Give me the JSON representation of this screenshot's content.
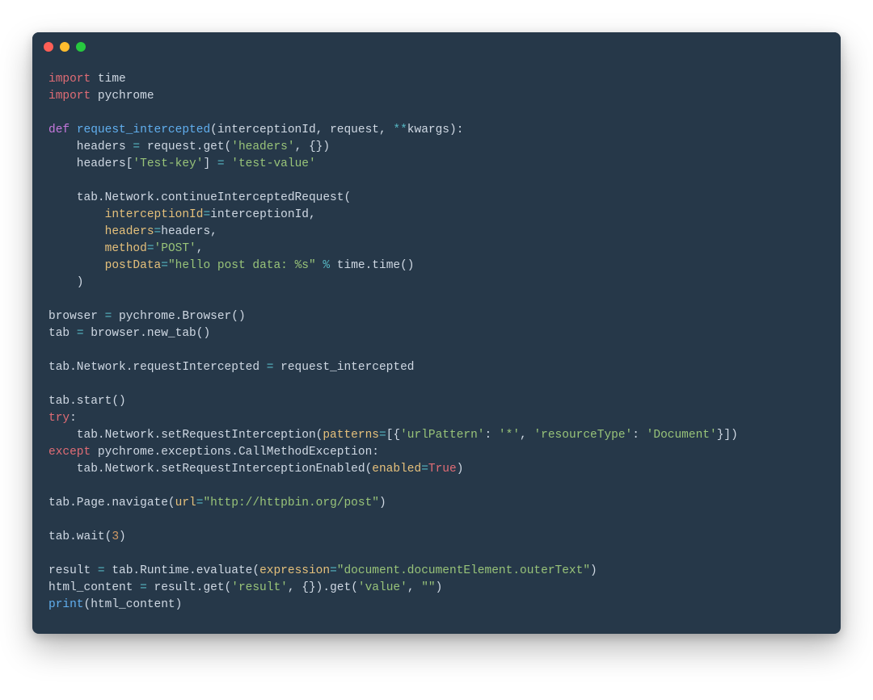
{
  "window": {
    "traffic_lights": [
      "red",
      "yellow",
      "green"
    ]
  },
  "code": {
    "tokens": [
      [
        [
          "import",
          "keyword"
        ],
        [
          " time",
          "default"
        ]
      ],
      [
        [
          "import",
          "keyword"
        ],
        [
          " pychrome",
          "default"
        ]
      ],
      [
        [
          "",
          "default"
        ]
      ],
      [
        [
          "def ",
          "keyword2"
        ],
        [
          "request_intercepted",
          "func"
        ],
        [
          "(interceptionId, request, ",
          "default"
        ],
        [
          "**",
          "op"
        ],
        [
          "kwargs):",
          "default"
        ]
      ],
      [
        [
          "    headers ",
          "default"
        ],
        [
          "=",
          "op"
        ],
        [
          " request.get(",
          "default"
        ],
        [
          "'headers'",
          "string"
        ],
        [
          ", {})",
          "default"
        ]
      ],
      [
        [
          "    headers[",
          "default"
        ],
        [
          "'Test-key'",
          "string"
        ],
        [
          "] ",
          "default"
        ],
        [
          "=",
          "op"
        ],
        [
          " ",
          "default"
        ],
        [
          "'test-value'",
          "string"
        ]
      ],
      [
        [
          "",
          "default"
        ]
      ],
      [
        [
          "    tab.Network.continueInterceptedRequest(",
          "default"
        ]
      ],
      [
        [
          "        ",
          "default"
        ],
        [
          "interceptionId",
          "param"
        ],
        [
          "=",
          "op"
        ],
        [
          "interceptionId,",
          "default"
        ]
      ],
      [
        [
          "        ",
          "default"
        ],
        [
          "headers",
          "param"
        ],
        [
          "=",
          "op"
        ],
        [
          "headers,",
          "default"
        ]
      ],
      [
        [
          "        ",
          "default"
        ],
        [
          "method",
          "param"
        ],
        [
          "=",
          "op"
        ],
        [
          "'POST'",
          "string"
        ],
        [
          ",",
          "default"
        ]
      ],
      [
        [
          "        ",
          "default"
        ],
        [
          "postData",
          "param"
        ],
        [
          "=",
          "op"
        ],
        [
          "\"hello post data: %s\"",
          "string"
        ],
        [
          " ",
          "default"
        ],
        [
          "%",
          "op"
        ],
        [
          " time.time()",
          "default"
        ]
      ],
      [
        [
          "    )",
          "default"
        ]
      ],
      [
        [
          "",
          "default"
        ]
      ],
      [
        [
          "browser ",
          "default"
        ],
        [
          "=",
          "op"
        ],
        [
          " pychrome.Browser()",
          "default"
        ]
      ],
      [
        [
          "tab ",
          "default"
        ],
        [
          "=",
          "op"
        ],
        [
          " browser.new_tab()",
          "default"
        ]
      ],
      [
        [
          "",
          "default"
        ]
      ],
      [
        [
          "tab.Network.requestIntercepted ",
          "default"
        ],
        [
          "=",
          "op"
        ],
        [
          " request_intercepted",
          "default"
        ]
      ],
      [
        [
          "",
          "default"
        ]
      ],
      [
        [
          "tab.start()",
          "default"
        ]
      ],
      [
        [
          "try",
          "keyword"
        ],
        [
          ":",
          "default"
        ]
      ],
      [
        [
          "    tab.Network.setRequestInterception(",
          "default"
        ],
        [
          "patterns",
          "param"
        ],
        [
          "=",
          "op"
        ],
        [
          "[{",
          "default"
        ],
        [
          "'urlPattern'",
          "string"
        ],
        [
          ": ",
          "default"
        ],
        [
          "'*'",
          "string"
        ],
        [
          ", ",
          "default"
        ],
        [
          "'resourceType'",
          "string"
        ],
        [
          ": ",
          "default"
        ],
        [
          "'Document'",
          "string"
        ],
        [
          "}])",
          "default"
        ]
      ],
      [
        [
          "except",
          "keyword"
        ],
        [
          " pychrome.exceptions.CallMethodException:",
          "default"
        ]
      ],
      [
        [
          "    tab.Network.setRequestInterceptionEnabled(",
          "default"
        ],
        [
          "enabled",
          "param"
        ],
        [
          "=",
          "op"
        ],
        [
          "True",
          "bool"
        ],
        [
          ")",
          "default"
        ]
      ],
      [
        [
          "",
          "default"
        ]
      ],
      [
        [
          "tab.Page.navigate(",
          "default"
        ],
        [
          "url",
          "param"
        ],
        [
          "=",
          "op"
        ],
        [
          "\"http://httpbin.org/post\"",
          "string"
        ],
        [
          ")",
          "default"
        ]
      ],
      [
        [
          "",
          "default"
        ]
      ],
      [
        [
          "tab.wait(",
          "default"
        ],
        [
          "3",
          "number"
        ],
        [
          ")",
          "default"
        ]
      ],
      [
        [
          "",
          "default"
        ]
      ],
      [
        [
          "result ",
          "default"
        ],
        [
          "=",
          "op"
        ],
        [
          " tab.Runtime.evaluate(",
          "default"
        ],
        [
          "expression",
          "param"
        ],
        [
          "=",
          "op"
        ],
        [
          "\"document.documentElement.outerText\"",
          "string"
        ],
        [
          ")",
          "default"
        ]
      ],
      [
        [
          "html_content ",
          "default"
        ],
        [
          "=",
          "op"
        ],
        [
          " result.get(",
          "default"
        ],
        [
          "'result'",
          "string"
        ],
        [
          ", {}).get(",
          "default"
        ],
        [
          "'value'",
          "string"
        ],
        [
          ", ",
          "default"
        ],
        [
          "\"\"",
          "string"
        ],
        [
          ")",
          "default"
        ]
      ],
      [
        [
          "print",
          "func"
        ],
        [
          "(html_content)",
          "default"
        ]
      ]
    ]
  }
}
